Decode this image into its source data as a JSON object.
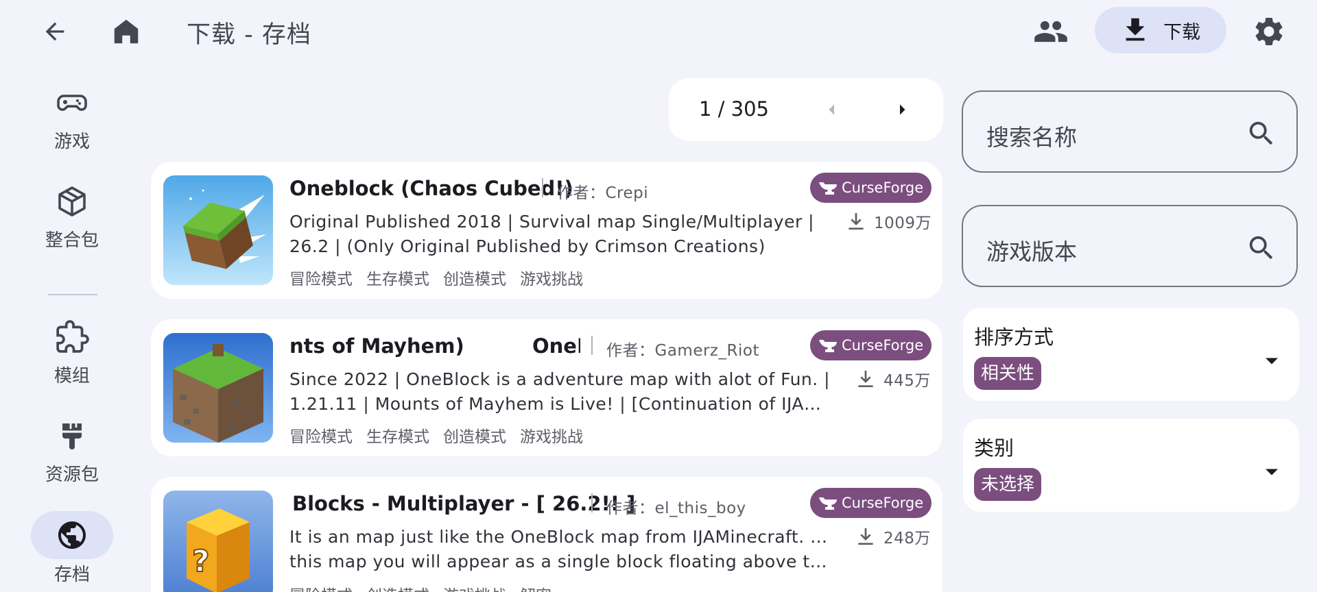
{
  "header": {
    "title": "下载 - 存档",
    "download_label": "下载"
  },
  "nav": {
    "items": [
      {
        "label": "游戏",
        "icon": "gamepad-icon"
      },
      {
        "label": "整合包",
        "icon": "package-icon"
      },
      {
        "label": "模组",
        "icon": "puzzle-icon"
      },
      {
        "label": "资源包",
        "icon": "paintbrush-icon"
      },
      {
        "label": "存档",
        "icon": "globe-icon",
        "active": true
      }
    ]
  },
  "pager": {
    "current": 1,
    "total": 305,
    "text": "1 / 305"
  },
  "results": [
    {
      "title": "Oneblock (Chaos Cubed!)",
      "author": "作者：Crepi",
      "source": "CurseForge",
      "downloads": "1009万",
      "description": [
        "Original Published 2018 | Survival map Single/Multiplayer |",
        "26.2 | (Only Original Published by Crimson Creations)"
      ],
      "tags": [
        "冒险模式",
        "生存模式",
        "创造模式",
        "游戏挑战"
      ]
    },
    {
      "title_left": "nts of Mayhem)",
      "title_right": "OneB",
      "author": "作者：Gamerz_Riot",
      "source": "CurseForge",
      "downloads": "445万",
      "description": [
        "Since 2022 | OneBlock is a adventure map with alot of Fun. |",
        "1.21.11 | Mounts of Mayhem is Live! | [Continuation of IJAMinecraft"
      ],
      "tags": [
        "冒险模式",
        "生存模式",
        "创造模式",
        "游戏挑战"
      ]
    },
    {
      "title": "Blocks - Multiplayer -  [ 26.2!! ]",
      "author": "作者：el_this_boy",
      "source": "CurseForge",
      "downloads": "248万",
      "description": [
        "It is an map just like the OneBlock map from IJAMinecraft. On",
        "this map you will appear as a single block floating above the void"
      ],
      "tags": [
        "冒险模式",
        "创造模式",
        "游戏挑战",
        "解密"
      ]
    }
  ],
  "filters": {
    "search_placeholder": "搜索名称",
    "version_placeholder": "游戏版本",
    "sort": {
      "title": "排序方式",
      "value": "相关性"
    },
    "category": {
      "title": "类别",
      "value": "未选择"
    }
  },
  "colors": {
    "background": "#f3f3fb",
    "accent_container": "#dde2f7",
    "curseforge_badge": "#7b4e7f",
    "card": "#ffffff"
  }
}
